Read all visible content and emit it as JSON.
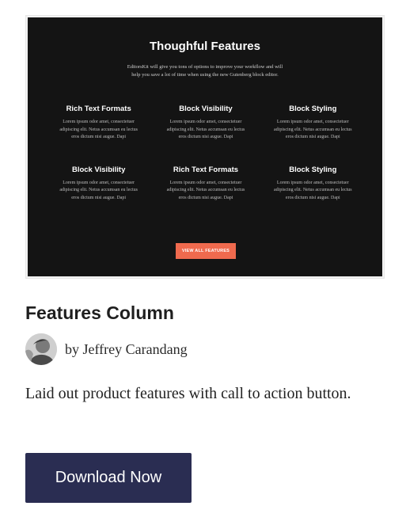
{
  "preview": {
    "title": "Thoughful Features",
    "intro": "EditorsKit will give you tons of options to improve your workflow and will help you save a lot of time when using the new Gutenberg block editor.",
    "features": [
      {
        "title": "Rich Text Formats",
        "text": "Lorem ipsum odor amet, consectetuer adipiscing elit. Netus accumsan eu lectus eros dictum nisi augue. Dapi"
      },
      {
        "title": "Block Visibility",
        "text": "Lorem ipsum odor amet, consectetuer adipiscing elit. Netus accumsan eu lectus eros dictum nisi augue. Dapi"
      },
      {
        "title": "Block Styling",
        "text": "Lorem ipsum odor amet, consectetuer adipiscing elit. Netus accumsan eu lectus eros dictum nisi augue. Dapi"
      },
      {
        "title": "Block Visibility",
        "text": "Lorem ipsum odor amet, consectetuer adipiscing elit. Netus accumsan eu lectus eros dictum nisi augue. Dapi"
      },
      {
        "title": "Rich Text Formats",
        "text": "Lorem ipsum odor amet, consectetuer adipiscing elit. Netus accumsan eu lectus eros dictum nisi augue. Dapi"
      },
      {
        "title": "Block Styling",
        "text": "Lorem ipsum odor amet, consectetuer adipiscing elit. Netus accumsan eu lectus eros dictum nisi augue. Dapi"
      }
    ],
    "button_label": "VIEW ALL FEATURES"
  },
  "card": {
    "title": "Features Column",
    "author_line": "by Jeffrey Carandang",
    "description": "Laid out product features with call to action button.",
    "download_label": "Download Now"
  },
  "colors": {
    "preview_bg": "#141414",
    "preview_accent": "#ef6a4e",
    "button_bg": "#2a2d52"
  }
}
